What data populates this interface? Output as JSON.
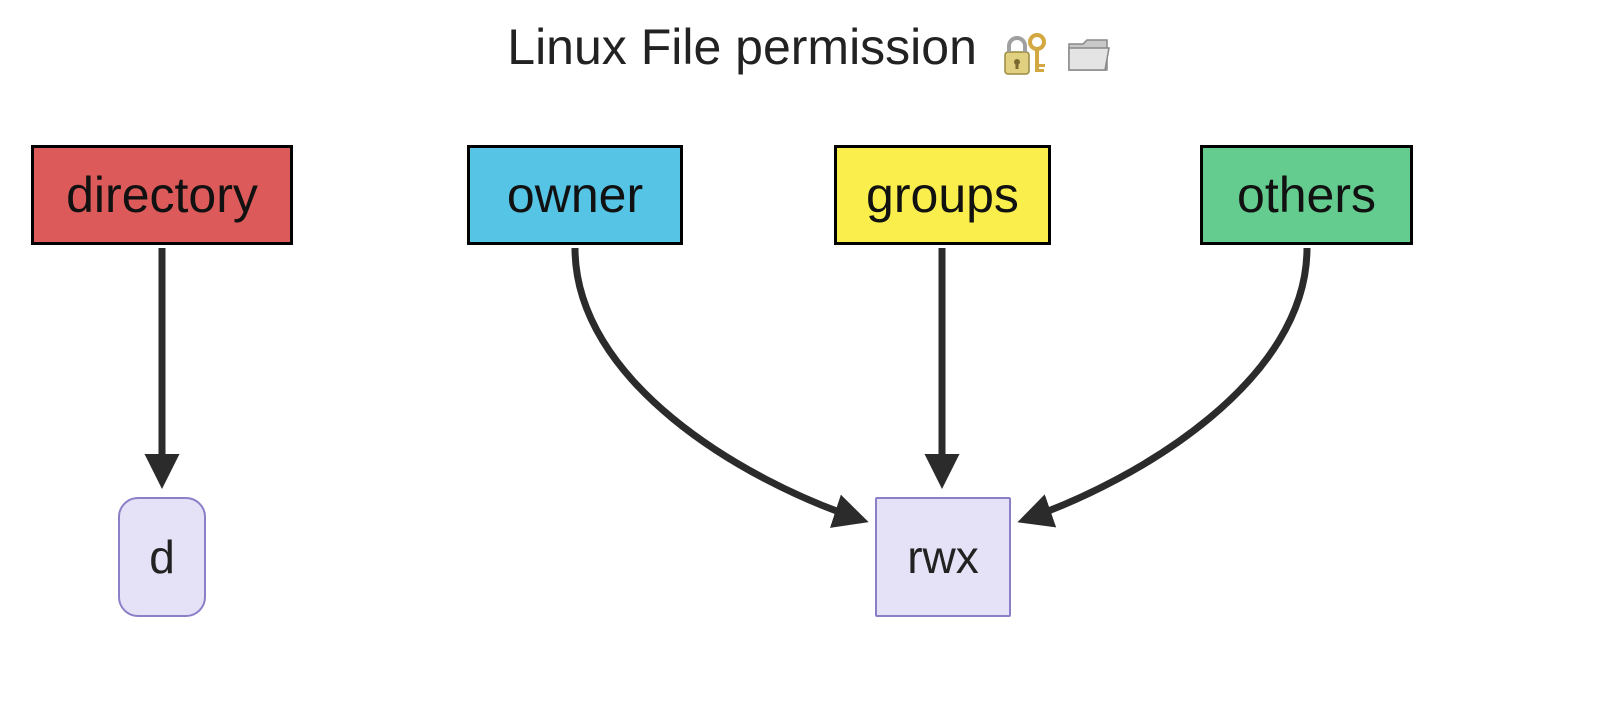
{
  "title": "Linux File permission",
  "icons": {
    "lock": "🔐",
    "folder": "📁"
  },
  "nodes": {
    "directory": {
      "label": "directory",
      "color": "#dc5a5a"
    },
    "owner": {
      "label": "owner",
      "color": "#55c4e5"
    },
    "groups": {
      "label": "groups",
      "color": "#f9ee4b"
    },
    "others": {
      "label": "others",
      "color": "#63cc8e"
    },
    "d": {
      "label": "d",
      "color": "#e5e1f6"
    },
    "rwx": {
      "label": "rwx",
      "color": "#e5e1f6"
    }
  },
  "edges": [
    {
      "from": "directory",
      "to": "d"
    },
    {
      "from": "owner",
      "to": "rwx"
    },
    {
      "from": "groups",
      "to": "rwx"
    },
    {
      "from": "others",
      "to": "rwx"
    }
  ]
}
